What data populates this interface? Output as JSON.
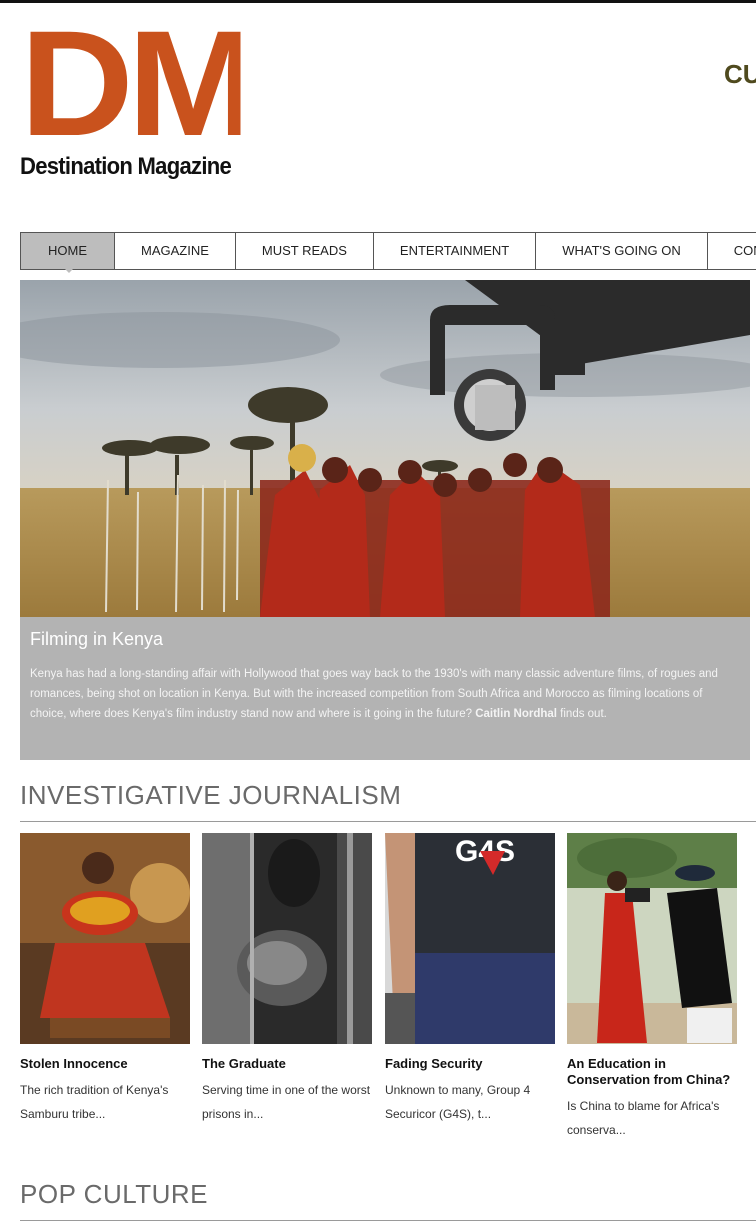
{
  "brand": {
    "logo_text": "DM",
    "name": "Destination Magazine",
    "accent": "#c9521d"
  },
  "header_right_text": "CU",
  "nav": {
    "items": [
      {
        "label": "HOME",
        "active": true
      },
      {
        "label": "MAGAZINE",
        "active": false
      },
      {
        "label": "MUST READS",
        "active": false
      },
      {
        "label": "ENTERTAINMENT",
        "active": false
      },
      {
        "label": "WHAT'S GOING ON",
        "active": false
      },
      {
        "label": "CONNEC",
        "active": false
      }
    ]
  },
  "hero": {
    "title": "Filming in Kenya",
    "text": "Kenya has had a long-standing affair with Hollywood that goes way back to the 1930's with many classic adventure films, of rogues and romances, being shot on location in Kenya. But with the increased competition from South Africa and Morocco as filming locations of choice, where does Kenya's film industry stand now and where is it going in the future?",
    "author": "Caitlin Nordhal",
    "author_suffix": " finds out."
  },
  "sections": {
    "investigative": {
      "title": "INVESTIGATIVE JOURNALISM",
      "cards": [
        {
          "title": "Stolen Innocence",
          "excerpt": "The rich tradition of Kenya's Samburu tribe..."
        },
        {
          "title": "The Graduate",
          "excerpt": "Serving time in one of the worst prisons in..."
        },
        {
          "title": "Fading Security",
          "excerpt": "Unknown to many, Group 4 Securicor (G4S), t..."
        },
        {
          "title": "An Education in Conservation from China?",
          "excerpt": "Is China to blame for Africa's conserva..."
        }
      ],
      "g4s_logo_text": "G4S"
    },
    "pop_culture": {
      "title": "POP CULTURE"
    }
  }
}
